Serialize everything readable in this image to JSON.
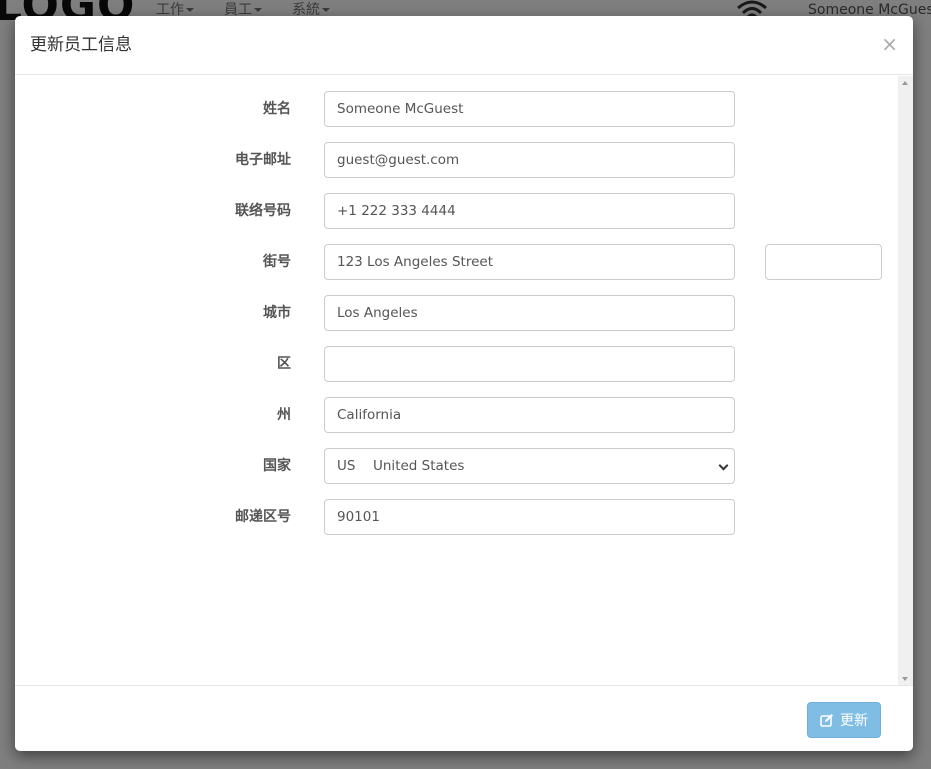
{
  "app_header": {
    "logo": "LOGO",
    "nav": [
      {
        "label": "工作"
      },
      {
        "label": "員工"
      },
      {
        "label": "系統"
      }
    ],
    "user": "Someone McGuest"
  },
  "modal": {
    "title": "更新员工信息",
    "close_symbol": "×",
    "fields": {
      "name": {
        "label": "姓名",
        "value": "Someone McGuest"
      },
      "email": {
        "label": "电子邮址",
        "value": "guest@guest.com"
      },
      "phone": {
        "label": "联络号码",
        "value": "+1 222 333 4444"
      },
      "street": {
        "label": "街号",
        "value": "123 Los Angeles Street",
        "extra_value": ""
      },
      "city": {
        "label": "城市",
        "value": "Los Angeles"
      },
      "district": {
        "label": "区",
        "value": ""
      },
      "state": {
        "label": "州",
        "value": "California"
      },
      "country": {
        "label": "国家",
        "code": "US",
        "name": "United States"
      },
      "postal": {
        "label": "邮递区号",
        "value": "90101"
      }
    },
    "footer": {
      "update_label": "更新"
    }
  },
  "colors": {
    "primary_button": "#7fbde4",
    "backdrop": "rgba(0,0,0,0.5)"
  }
}
